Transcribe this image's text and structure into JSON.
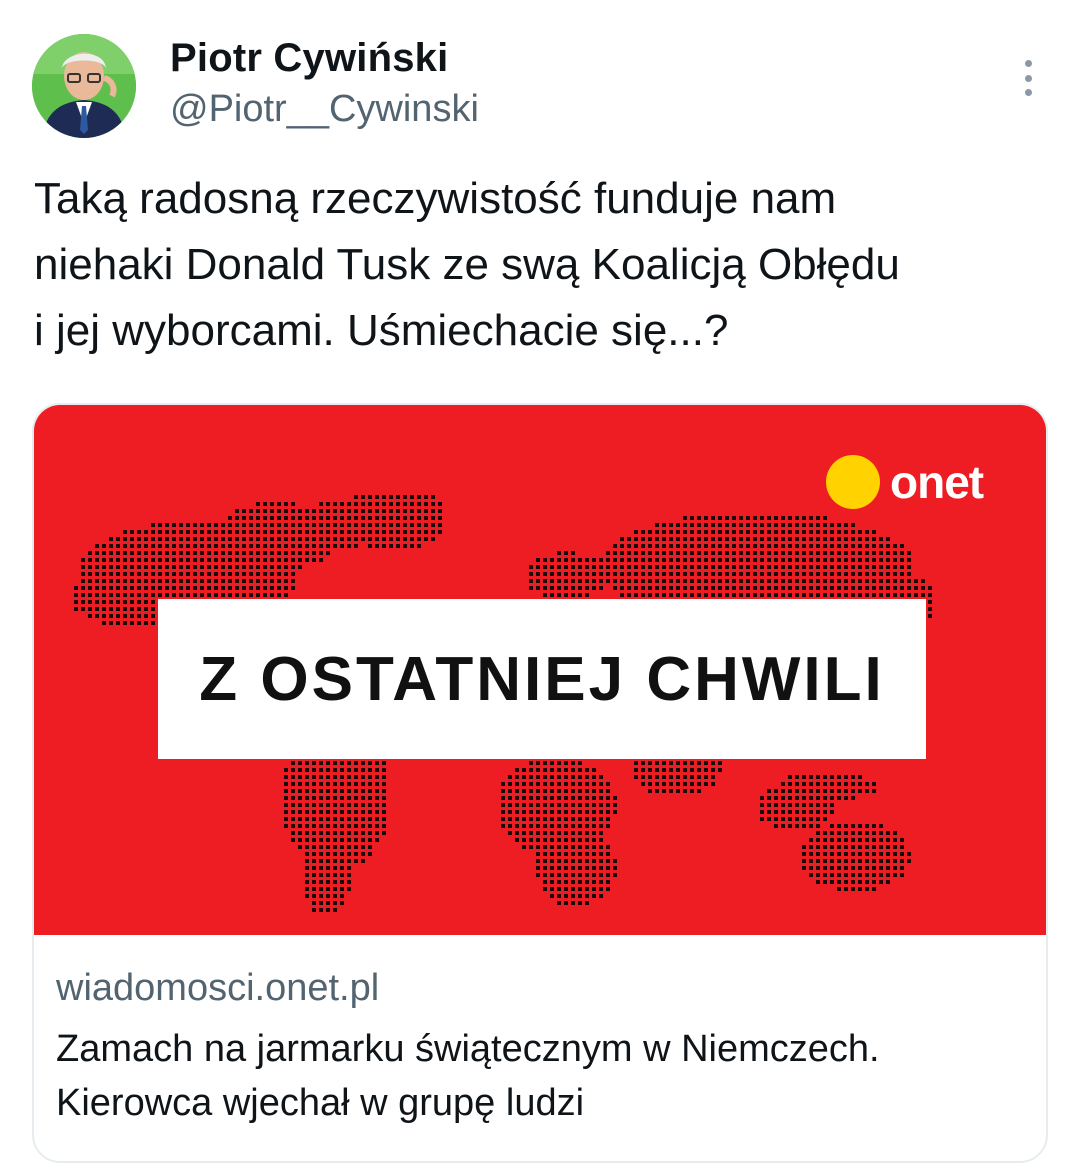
{
  "author": {
    "display_name": "Piotr Cywiński",
    "handle": "@Piotr__Cywinski",
    "avatar_icon": "profile-photo"
  },
  "more_icon": "more-vertical-icon",
  "tweet": {
    "text": "Taką radosną rzeczywistość funduje nam\nniehaki Donald Tusk ze swą Koalicją Obłędu\ni jej wyborcami. Uśmiechacie się...?"
  },
  "link_card": {
    "image": {
      "background_color": "#ee1c23",
      "logo_text": "onet",
      "logo_dot_color": "#ffd200",
      "banner_text": "Z OSTATNIEJ CHWILI",
      "map_icon": "dotted-world-map"
    },
    "domain": "wiadomosci.onet.pl",
    "title": "Zamach na jarmarku świątecznym w Niemczech.\nKierowca wjechał w grupę ludzi"
  }
}
